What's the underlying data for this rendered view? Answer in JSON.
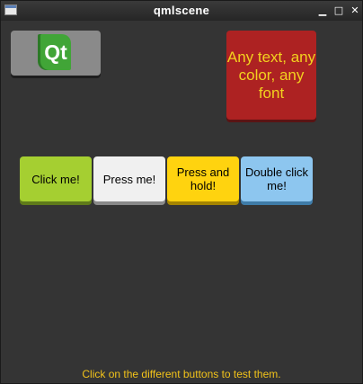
{
  "window": {
    "title": "qmlscene",
    "minimize_glyph": "▁",
    "maximize_glyph": "□",
    "close_glyph": "✕",
    "app_icon": "window-icon"
  },
  "qt_button": {
    "logo_text": "Qt",
    "icon": "qt-logo-icon"
  },
  "any_text_button": {
    "label": "Any text, any color, any font",
    "text_color": "#f2d11f",
    "background": "#ad2222"
  },
  "buttons": [
    {
      "label": "Click me!",
      "color": "#a5cf31"
    },
    {
      "label": "Press me!",
      "color": "#f0f0f0"
    },
    {
      "label": "Press and hold!",
      "color": "#ffd30f"
    },
    {
      "label": "Double click me!",
      "color": "#8dc6ef"
    }
  ],
  "footer": {
    "hint": "Click on the different buttons to test them."
  }
}
